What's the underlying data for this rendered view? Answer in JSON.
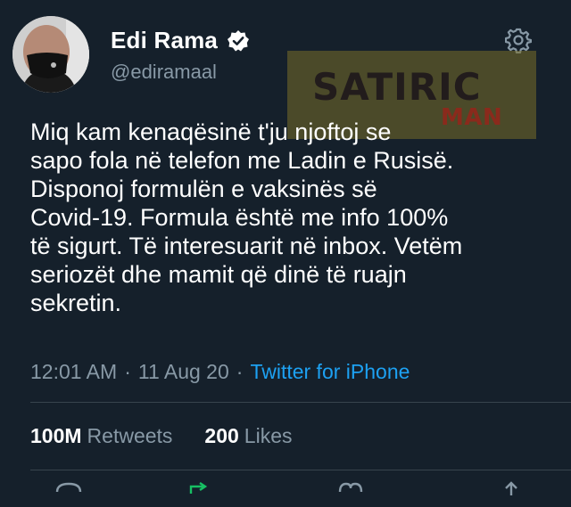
{
  "user": {
    "name": "Edi Rama",
    "handle": "@ediramaal"
  },
  "watermark": {
    "top": "SATIRIC",
    "bottom": "MAN"
  },
  "tweet": {
    "lines": [
      "Miq kam kenaqësinë t'ju njoftoj se",
      "sapo fola në telefon me Ladin e Rusisë.",
      "Disponoj formulën e vaksinës së",
      "Covid-19. Formula është me info 100%",
      "të sigurt. Të interesuarit në inbox. Vetëm",
      "seriozët dhe mamit që dinë të ruajn",
      "sekretin."
    ],
    "time": "12:01 AM",
    "date": "11 Aug 20",
    "source": "Twitter for iPhone"
  },
  "stats": {
    "retweets_count": "100M",
    "retweets_label": "Retweets",
    "likes_count": "200",
    "likes_label": "Likes"
  },
  "colors": {
    "background": "#15202b",
    "secondary_text": "#8899a6",
    "link": "#1da1f2",
    "divider": "#38444d"
  },
  "icons": [
    "verified-icon",
    "gear-icon",
    "reply-icon",
    "retweet-icon",
    "like-icon",
    "share-icon"
  ]
}
